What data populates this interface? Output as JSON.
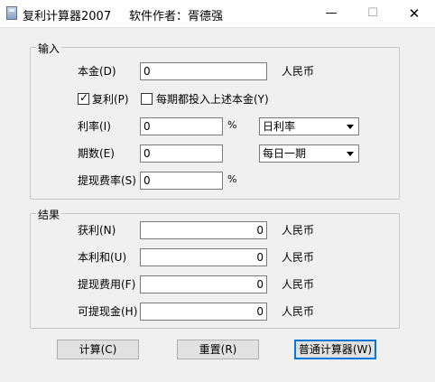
{
  "window": {
    "title": "复利计算器2007",
    "author": "软件作者：胥德强",
    "min_glyph": "—",
    "max_glyph": "☐",
    "close_glyph": "✕"
  },
  "input": {
    "legend": "输入",
    "principal_label": "本金(D)",
    "principal_value": "0",
    "principal_unit": "人民币",
    "compound_label": "复利(P)",
    "compound_checked": true,
    "compound_mark": "✓",
    "reinvest_label": "每期都投入上述本金(Y)",
    "reinvest_checked": false,
    "rate_label": "利率(I)",
    "rate_value": "0",
    "rate_unit": "%",
    "rate_type_selected": "日利率",
    "periods_label": "期数(E)",
    "periods_value": "0",
    "period_type_selected": "每日一期",
    "fee_label": "提现费率(S)",
    "fee_value": "0",
    "fee_unit": "%"
  },
  "result": {
    "legend": "结果",
    "profit_label": "获利(N)",
    "profit_value": "0",
    "profit_unit": "人民币",
    "total_label": "本利和(U)",
    "total_value": "0",
    "total_unit": "人民币",
    "fee_label": "提现费用(F)",
    "fee_value": "0",
    "fee_unit": "人民币",
    "withdraw_label": "可提现金(H)",
    "withdraw_value": "0",
    "withdraw_unit": "人民币"
  },
  "buttons": {
    "calculate": "计算(C)",
    "reset": "重置(R)",
    "standard": "普通计算器(W)"
  }
}
